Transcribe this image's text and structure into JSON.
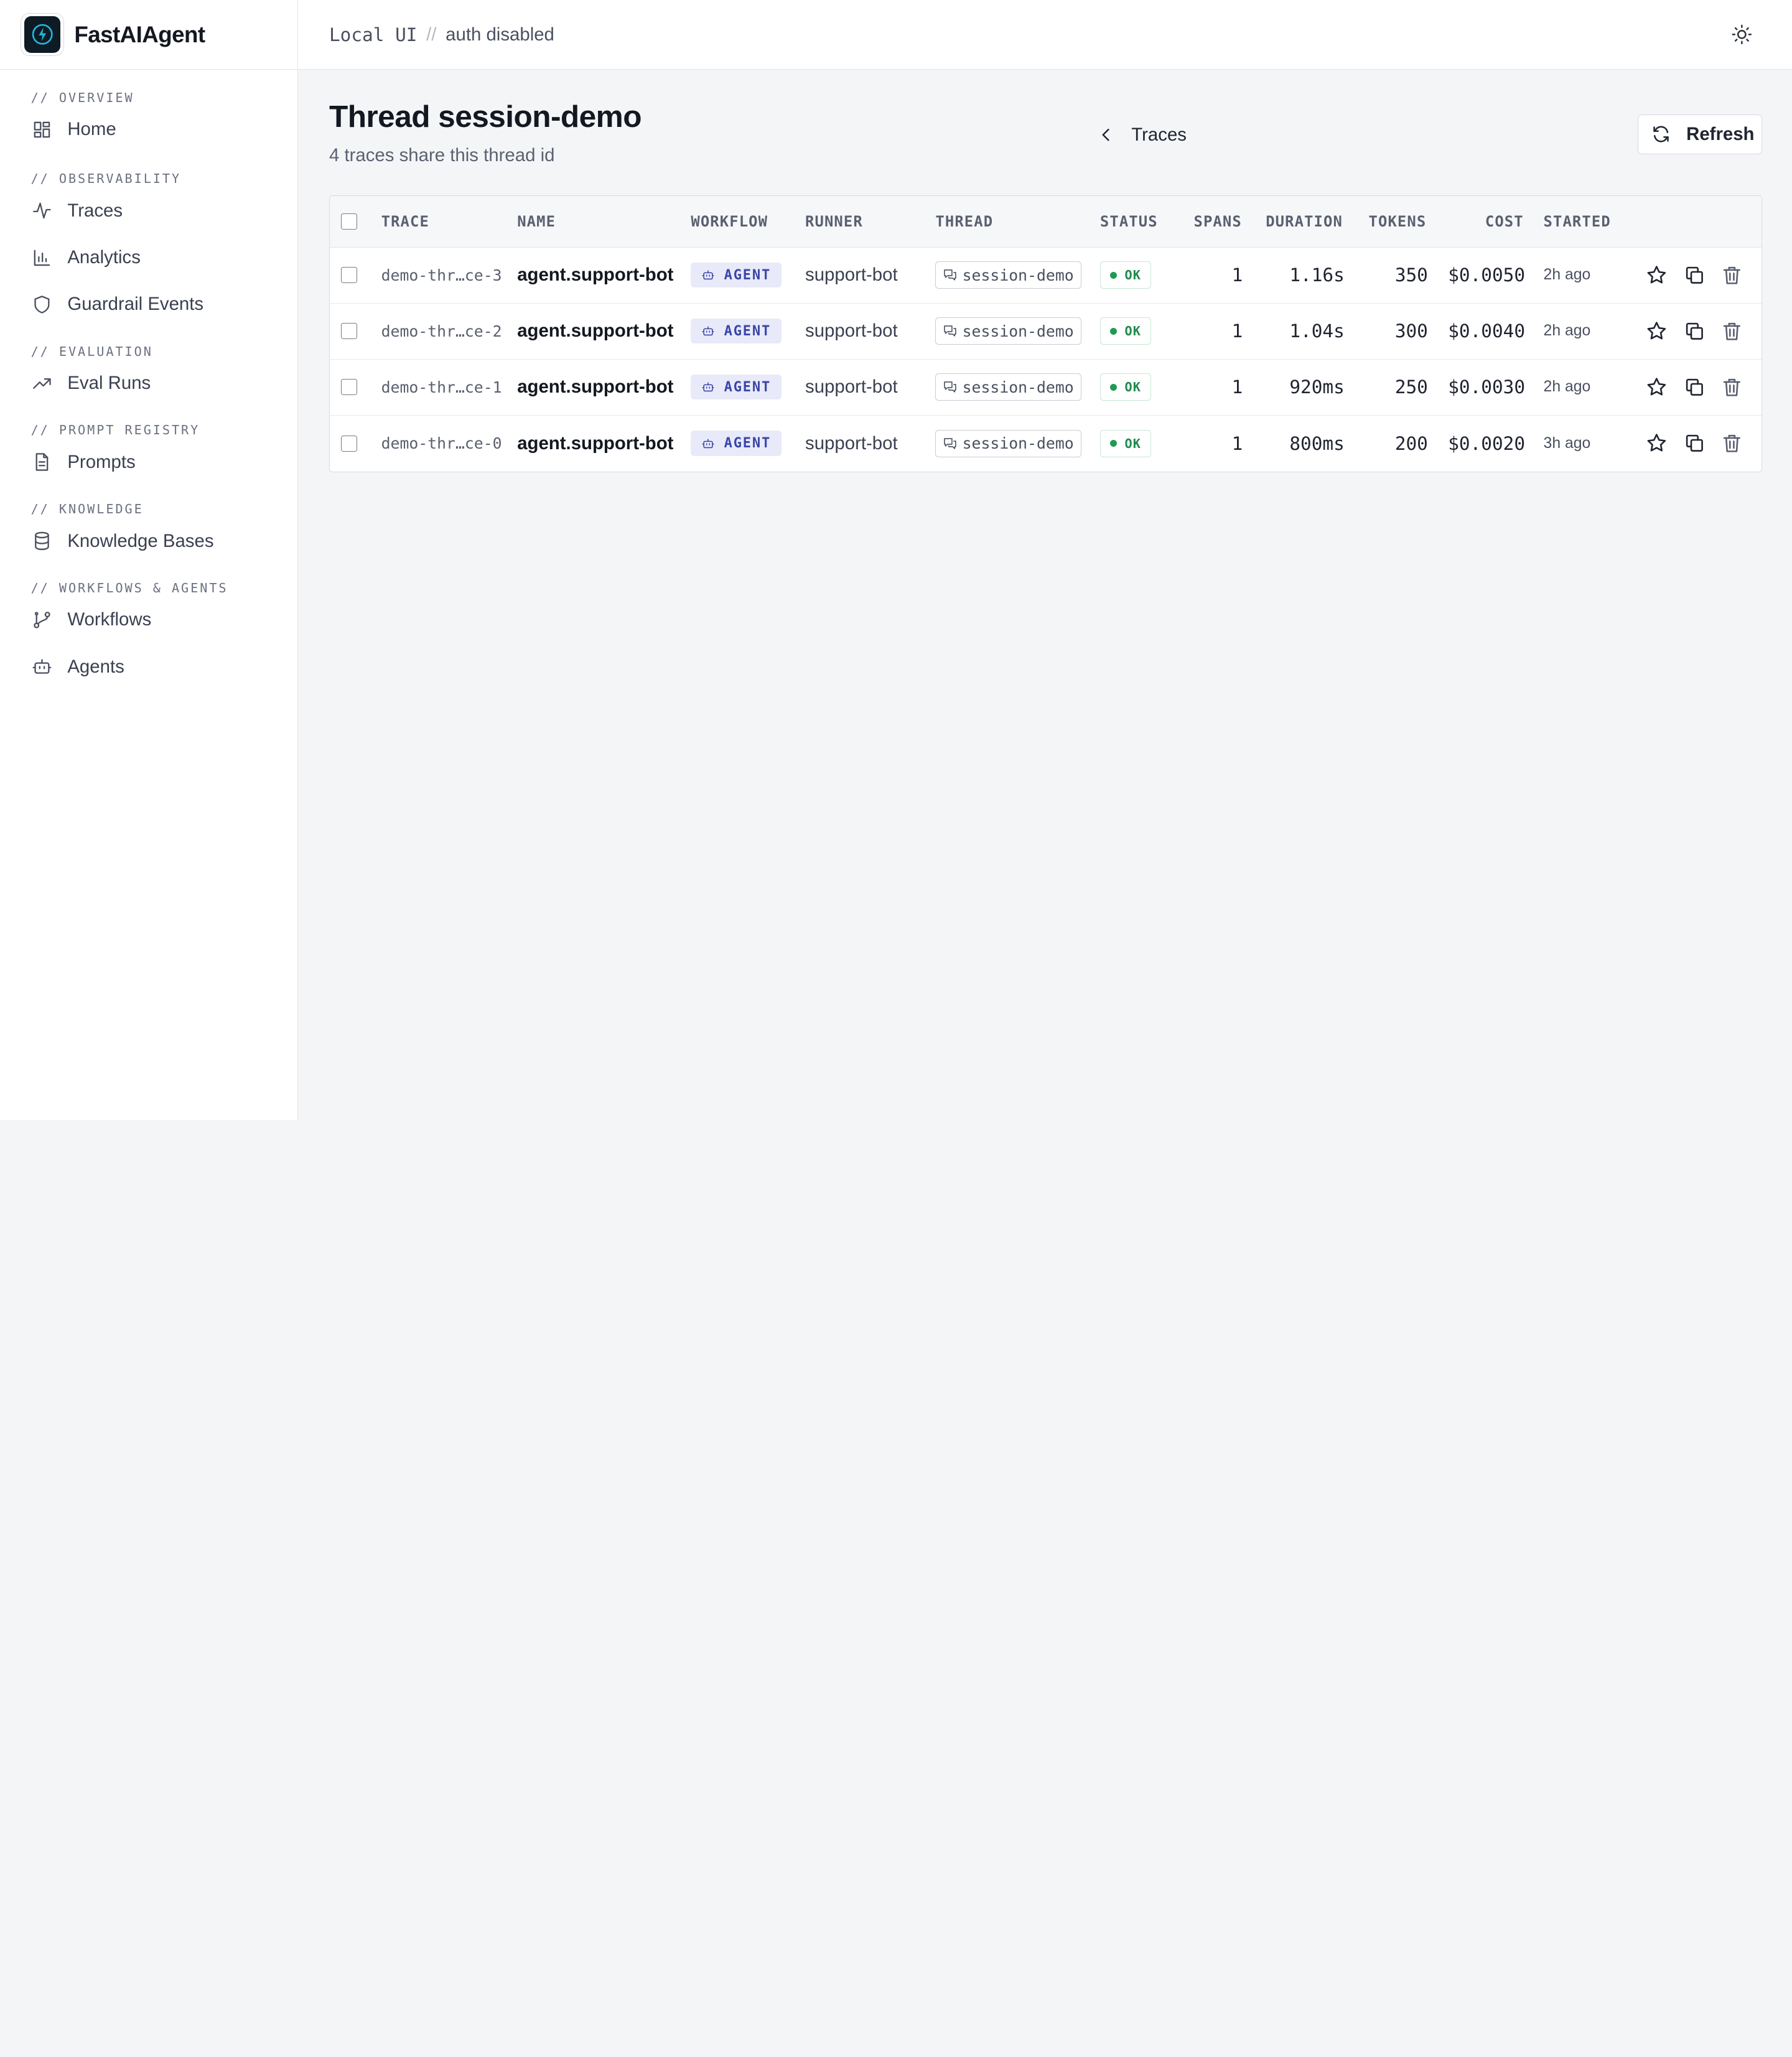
{
  "app": {
    "name": "FastAIAgent"
  },
  "topbar": {
    "mode": "Local UI",
    "separator": "//",
    "auth": "auth disabled"
  },
  "sidebar": {
    "sections": [
      {
        "title": "// OVERVIEW",
        "items": [
          {
            "label": "Home",
            "icon": "grid-icon"
          }
        ]
      },
      {
        "title": "// OBSERVABILITY",
        "items": [
          {
            "label": "Traces",
            "icon": "activity-icon"
          },
          {
            "label": "Analytics",
            "icon": "bar-chart-icon"
          },
          {
            "label": "Guardrail Events",
            "icon": "shield-icon"
          }
        ]
      },
      {
        "title": "// EVALUATION",
        "items": [
          {
            "label": "Eval Runs",
            "icon": "trending-up-icon"
          }
        ]
      },
      {
        "title": "// PROMPT REGISTRY",
        "items": [
          {
            "label": "Prompts",
            "icon": "file-text-icon"
          }
        ]
      },
      {
        "title": "// KNOWLEDGE",
        "items": [
          {
            "label": "Knowledge Bases",
            "icon": "database-icon"
          }
        ]
      },
      {
        "title": "// WORKFLOWS & AGENTS",
        "items": [
          {
            "label": "Workflows",
            "icon": "git-branch-icon"
          },
          {
            "label": "Agents",
            "icon": "bot-icon"
          }
        ]
      }
    ]
  },
  "page": {
    "title": "Thread session-demo",
    "subtitle": "4 traces share this thread id",
    "back_label": "Traces",
    "refresh_label": "Refresh"
  },
  "table": {
    "columns": [
      "TRACE",
      "NAME",
      "WORKFLOW",
      "RUNNER",
      "THREAD",
      "STATUS",
      "SPANS",
      "DURATION",
      "TOKENS",
      "COST",
      "STARTED"
    ],
    "rows": [
      {
        "trace": "demo-thr…ce-3",
        "name": "agent.support-bot",
        "workflow": "AGENT",
        "runner": "support-bot",
        "thread": "session-demo",
        "status": "OK",
        "spans": "1",
        "duration": "1.16s",
        "tokens": "350",
        "cost": "$0.0050",
        "started": "2h ago"
      },
      {
        "trace": "demo-thr…ce-2",
        "name": "agent.support-bot",
        "workflow": "AGENT",
        "runner": "support-bot",
        "thread": "session-demo",
        "status": "OK",
        "spans": "1",
        "duration": "1.04s",
        "tokens": "300",
        "cost": "$0.0040",
        "started": "2h ago"
      },
      {
        "trace": "demo-thr…ce-1",
        "name": "agent.support-bot",
        "workflow": "AGENT",
        "runner": "support-bot",
        "thread": "session-demo",
        "status": "OK",
        "spans": "1",
        "duration": "920ms",
        "tokens": "250",
        "cost": "$0.0030",
        "started": "2h ago"
      },
      {
        "trace": "demo-thr…ce-0",
        "name": "agent.support-bot",
        "workflow": "AGENT",
        "runner": "support-bot",
        "thread": "session-demo",
        "status": "OK",
        "spans": "1",
        "duration": "800ms",
        "tokens": "200",
        "cost": "$0.0020",
        "started": "3h ago"
      }
    ]
  },
  "colors": {
    "accent": "#3b46a8",
    "status_ok": "#1f9a52",
    "logo_bg": "#0e1a24",
    "logo_bolt": "#1fb6d9"
  }
}
